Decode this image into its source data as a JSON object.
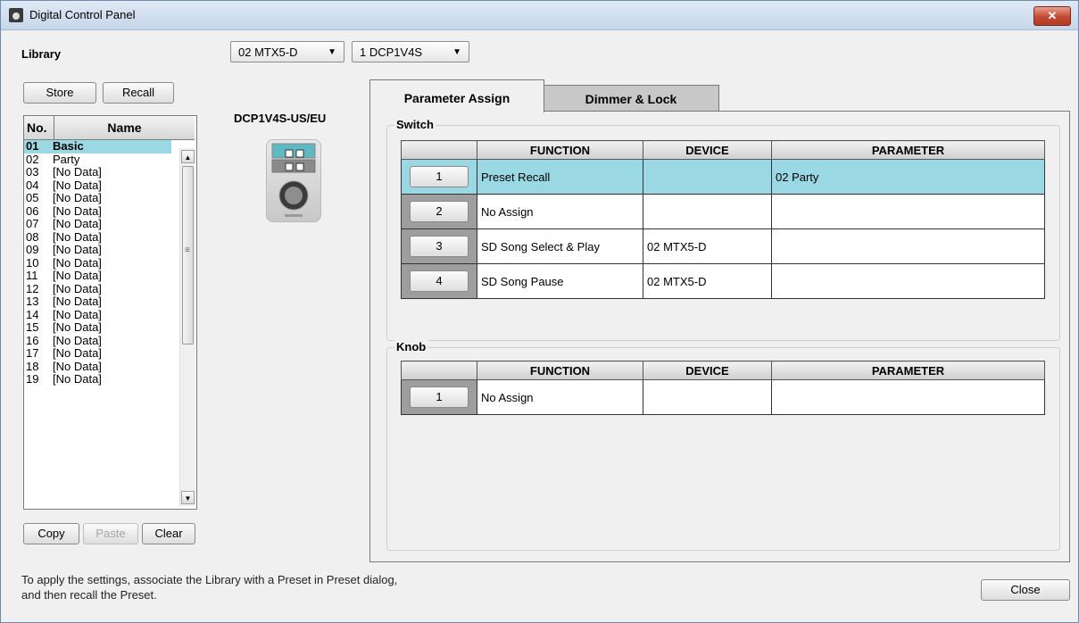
{
  "window": {
    "title": "Digital Control Panel",
    "close_glyph": "✕"
  },
  "library": {
    "label": "Library",
    "store": "Store",
    "recall": "Recall",
    "headers": {
      "no": "No.",
      "name": "Name"
    },
    "rows": [
      {
        "no": "01",
        "name": "Basic"
      },
      {
        "no": "02",
        "name": "Party"
      },
      {
        "no": "03",
        "name": "[No Data]"
      },
      {
        "no": "04",
        "name": "[No Data]"
      },
      {
        "no": "05",
        "name": "[No Data]"
      },
      {
        "no": "06",
        "name": "[No Data]"
      },
      {
        "no": "07",
        "name": "[No Data]"
      },
      {
        "no": "08",
        "name": "[No Data]"
      },
      {
        "no": "09",
        "name": "[No Data]"
      },
      {
        "no": "10",
        "name": "[No Data]"
      },
      {
        "no": "11",
        "name": "[No Data]"
      },
      {
        "no": "12",
        "name": "[No Data]"
      },
      {
        "no": "13",
        "name": "[No Data]"
      },
      {
        "no": "14",
        "name": "[No Data]"
      },
      {
        "no": "15",
        "name": "[No Data]"
      },
      {
        "no": "16",
        "name": "[No Data]"
      },
      {
        "no": "17",
        "name": "[No Data]"
      },
      {
        "no": "18",
        "name": "[No Data]"
      },
      {
        "no": "19",
        "name": "[No Data]"
      }
    ],
    "copy": "Copy",
    "paste": "Paste",
    "clear": "Clear"
  },
  "selectors": {
    "device": "02 MTX5-D",
    "panel": "1 DCP1V4S"
  },
  "model_name": "DCP1V4S-US/EU",
  "tabs": {
    "param": "Parameter Assign",
    "dimmer": "Dimmer & Lock"
  },
  "switch": {
    "label": "Switch",
    "headers": {
      "function": "FUNCTION",
      "device": "DEVICE",
      "parameter": "PARAMETER"
    },
    "rows": [
      {
        "num": "1",
        "function": "Preset Recall",
        "device": "",
        "parameter": "02 Party"
      },
      {
        "num": "2",
        "function": "No Assign",
        "device": "",
        "parameter": ""
      },
      {
        "num": "3",
        "function": "SD Song Select & Play",
        "device": "02 MTX5-D",
        "parameter": ""
      },
      {
        "num": "4",
        "function": "SD Song Pause",
        "device": "02 MTX5-D",
        "parameter": ""
      }
    ]
  },
  "knob": {
    "label": "Knob",
    "headers": {
      "function": "FUNCTION",
      "device": "DEVICE",
      "parameter": "PARAMETER"
    },
    "rows": [
      {
        "num": "1",
        "function": "No Assign",
        "device": "",
        "parameter": ""
      }
    ]
  },
  "footer": {
    "line1": "To apply the settings, associate the Library with a Preset in Preset dialog,",
    "line2": "and then recall the Preset."
  },
  "close": "Close",
  "colors": {
    "selection": "#9ad9e3",
    "accent_close": "#c24a32"
  }
}
